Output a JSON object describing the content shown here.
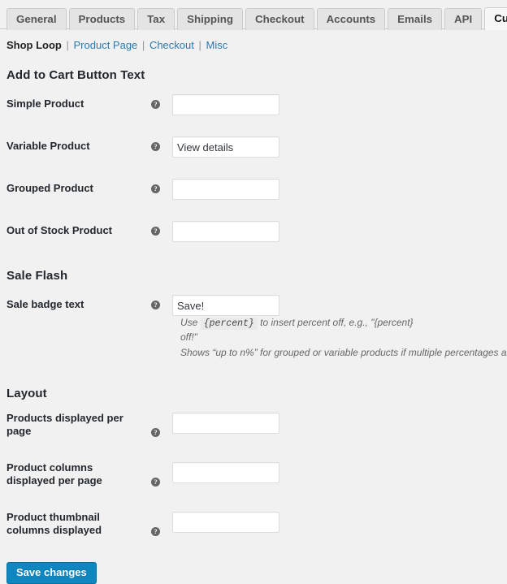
{
  "tabs": [
    {
      "label": "General",
      "active": false
    },
    {
      "label": "Products",
      "active": false
    },
    {
      "label": "Tax",
      "active": false
    },
    {
      "label": "Shipping",
      "active": false
    },
    {
      "label": "Checkout",
      "active": false
    },
    {
      "label": "Accounts",
      "active": false
    },
    {
      "label": "Emails",
      "active": false
    },
    {
      "label": "API",
      "active": false
    },
    {
      "label": "Customizer",
      "active": true
    }
  ],
  "subnav": {
    "current": "Shop Loop",
    "links": [
      "Product Page",
      "Checkout",
      "Misc"
    ],
    "separator": "|"
  },
  "sections": [
    {
      "title": "Add to Cart Button Text",
      "rows": [
        {
          "label": "Simple Product",
          "tip": "help-icon",
          "value": "",
          "placeholder": ""
        },
        {
          "label": "Variable Product",
          "tip": "help-icon",
          "value": "View details",
          "placeholder": ""
        },
        {
          "label": "Grouped Product",
          "tip": "help-icon",
          "value": "",
          "placeholder": ""
        },
        {
          "label": "Out of Stock Product",
          "tip": "help-icon",
          "value": "",
          "placeholder": ""
        }
      ]
    },
    {
      "title": "Sale Flash",
      "rows": [
        {
          "label": "Sale badge text",
          "tip": "help-icon",
          "value": "Save!",
          "placeholder": "",
          "desc_before": "Use",
          "desc_code": "{percent}",
          "desc_after": "to insert percent off, e.g., \"{percent} off!\"",
          "desc_second": "Shows “up to n%” for grouped or variable products if multiple percentages are possible."
        }
      ]
    },
    {
      "title": "Layout",
      "rows": [
        {
          "label": "Products displayed per page",
          "tip": "help-icon",
          "value": "",
          "placeholder": "",
          "tall": true
        },
        {
          "label": "Product columns displayed per page",
          "tip": "help-icon",
          "value": "",
          "placeholder": "",
          "tall": true
        },
        {
          "label": "Product thumbnail columns displayed",
          "tip": "help-icon",
          "value": "",
          "placeholder": "",
          "tall": true
        }
      ]
    }
  ],
  "submit": {
    "save_label": "Save changes"
  },
  "colors": {
    "page_background": "#f1f1f1",
    "tab_inactive": "#e4e4e4",
    "tab_active": "#f7f7f7",
    "link": "#2b7ab0",
    "primary_button": "#0e86c0",
    "heading": "#23282d"
  }
}
